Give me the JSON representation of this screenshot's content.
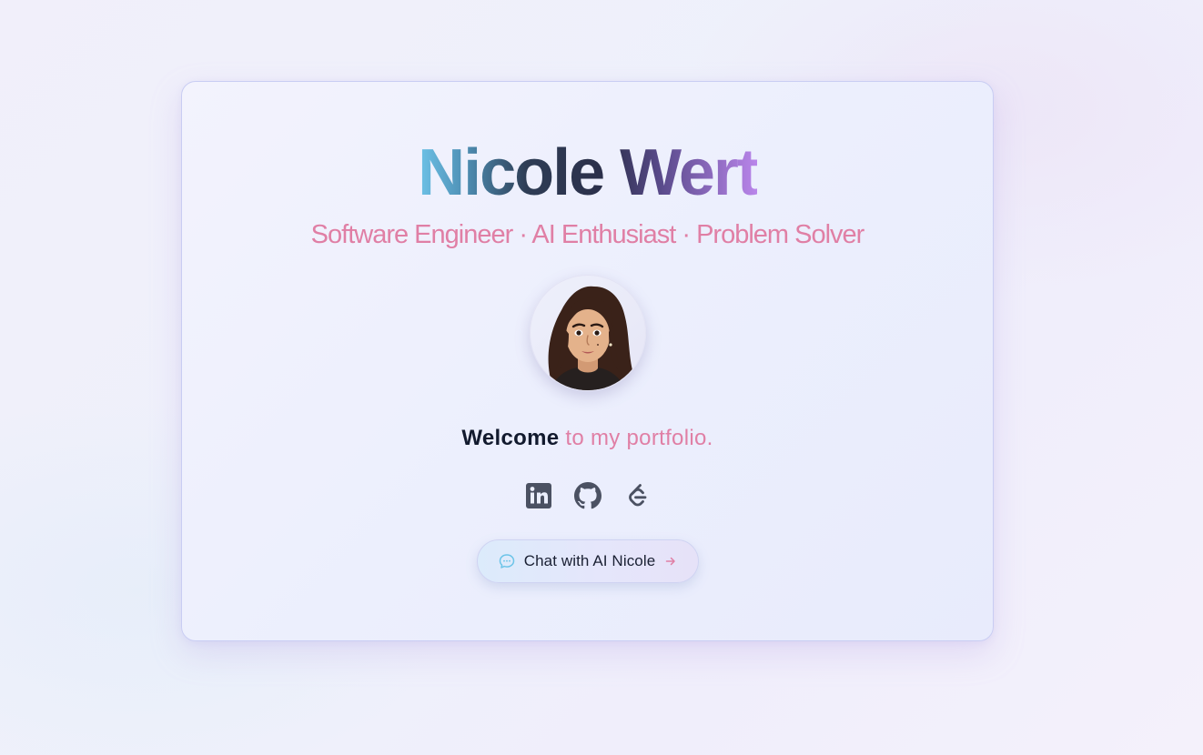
{
  "profile": {
    "name": "Nicole Wert",
    "tagline": "Software Engineer · AI Enthusiast · Problem Solver"
  },
  "welcome": {
    "strong": "Welcome",
    "rest": " to my portfolio."
  },
  "socials": [
    {
      "icon": "linkedin-icon"
    },
    {
      "icon": "github-icon"
    },
    {
      "icon": "leetcode-icon"
    }
  ],
  "chat_button": {
    "label": "Chat with AI Nicole",
    "leading_icon": "chat-bubble-icon",
    "trailing_icon": "arrow-right-icon"
  },
  "colors": {
    "accent_pink": "#e07fa5",
    "dark_text": "#121a2e",
    "card_border": "#c9cdf3",
    "icon_gray": "#4b5162"
  }
}
